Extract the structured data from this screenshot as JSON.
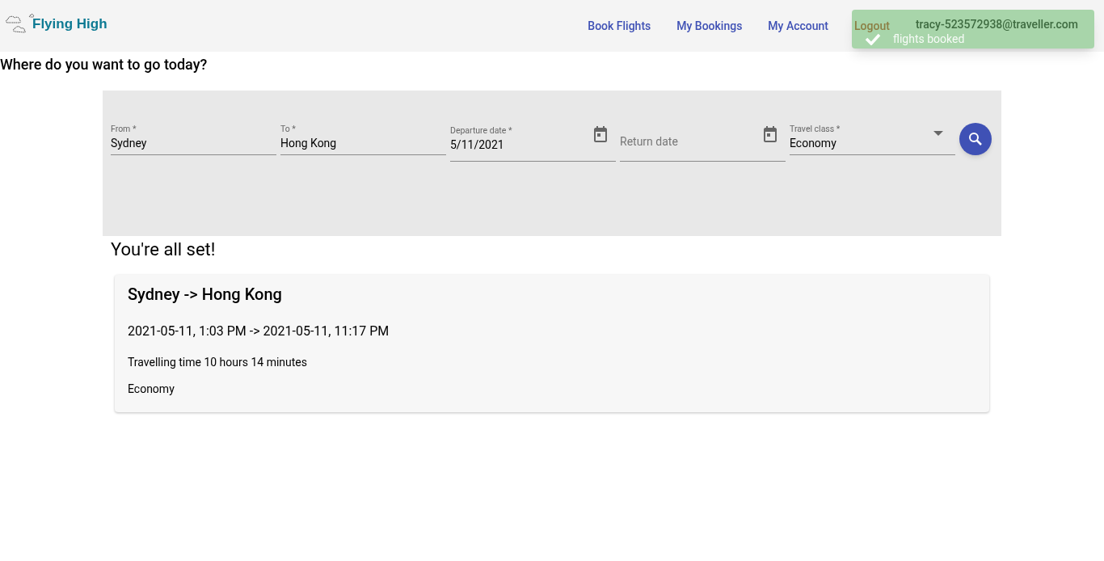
{
  "header": {
    "logo": "Flying High",
    "nav": [
      {
        "label": "Book Flights",
        "kind": "link"
      },
      {
        "label": "My Bookings",
        "kind": "link"
      },
      {
        "label": "My Account",
        "kind": "link"
      },
      {
        "label": "Logout",
        "kind": "logout"
      }
    ],
    "user_email": "tracy-523572938@traveller.com"
  },
  "toast": {
    "message": "flights booked"
  },
  "heading": "Where do you want to go today?",
  "search_form": {
    "fields": [
      {
        "kind": "text",
        "label": "From *",
        "value": "Sydney"
      },
      {
        "kind": "text",
        "label": "To *",
        "value": "Hong Kong"
      },
      {
        "kind": "date",
        "label": "Departure date *",
        "value": "5/11/2021"
      },
      {
        "kind": "date",
        "placeholder": "Return date"
      },
      {
        "kind": "select",
        "label": "Travel class *",
        "value": "Economy"
      }
    ]
  },
  "confirmation": {
    "title": "You're all set!",
    "card": {
      "route": "Sydney -> Hong Kong",
      "times": "2021-05-11, 1:03 PM -> 2021-05-11, 11:17 PM",
      "duration": "Travelling time 10 hours 14 minutes",
      "travel_class": "Economy"
    }
  }
}
